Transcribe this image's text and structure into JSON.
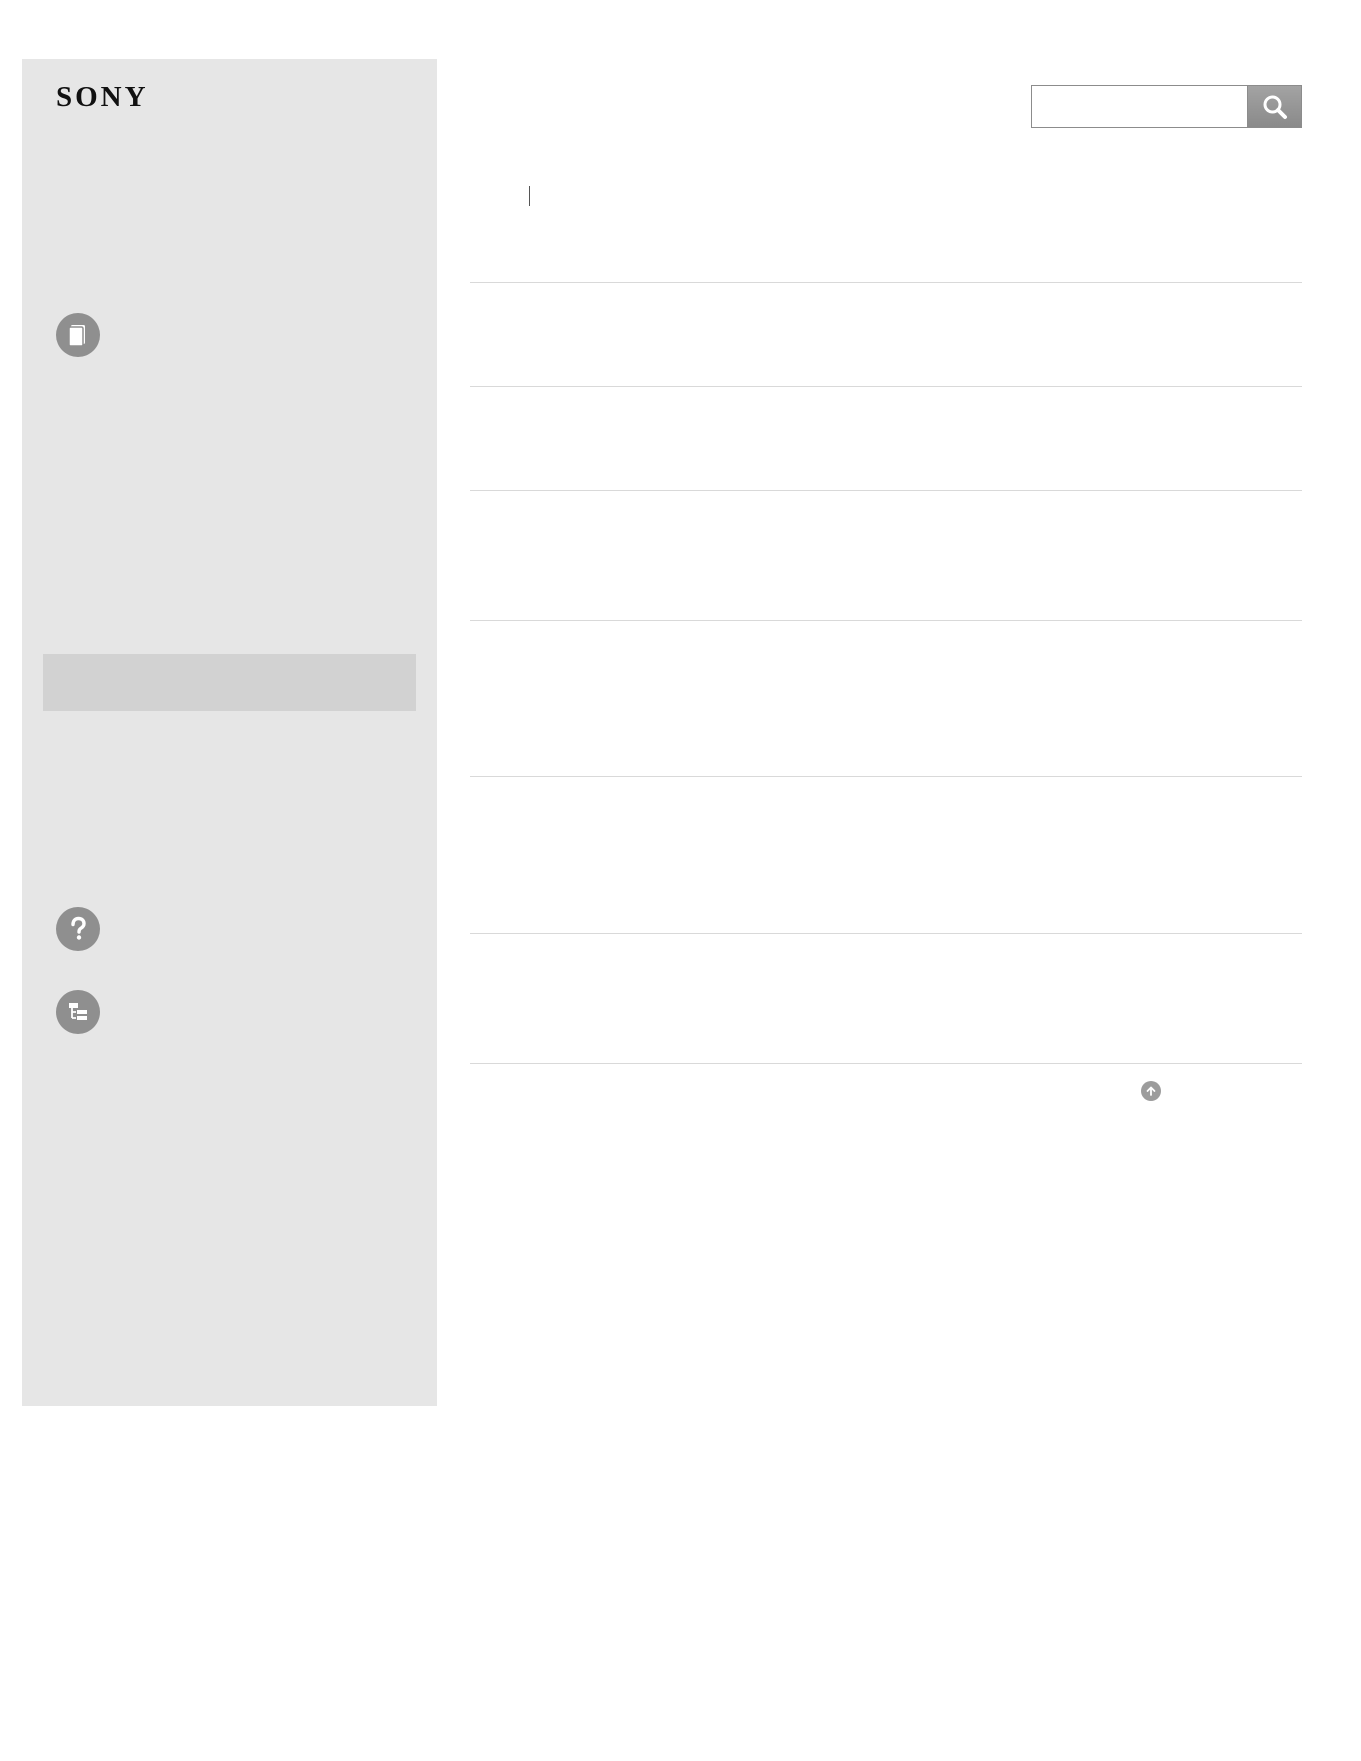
{
  "brand": {
    "logo_text": "SONY"
  },
  "search": {
    "value": "",
    "placeholder": ""
  },
  "sidebar": {
    "icons": [
      "book-icon",
      "help-icon",
      "sitemap-icon"
    ]
  },
  "main": {
    "sections_count_visible": 6
  },
  "colors": {
    "sidebar_bg": "#e6e6e6",
    "sidebar_highlight": "#d2d2d2",
    "icon_gray": "#8f8f8f",
    "divider": "#d9d9d9"
  }
}
